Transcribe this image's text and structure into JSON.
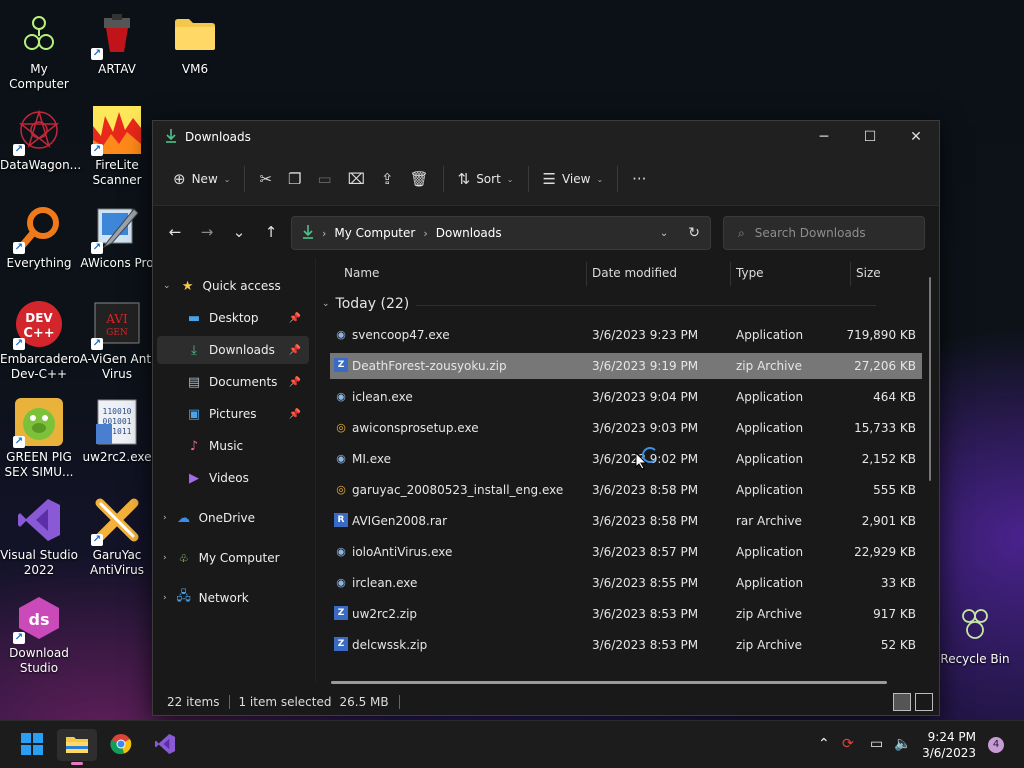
{
  "desktop": {
    "icons": [
      {
        "label": "My Computer"
      },
      {
        "label": "ARTAV"
      },
      {
        "label": "VM6"
      },
      {
        "label": "DataWagon..."
      },
      {
        "label": "FireLite Scanner"
      },
      {
        "label": "Everything"
      },
      {
        "label": "AWicons Pro"
      },
      {
        "label": "Embarcadero Dev-C++"
      },
      {
        "label": "A-ViGen Anti Virus"
      },
      {
        "label": "GREEN PIG SEX SIMU..."
      },
      {
        "label": "uw2rc2.exe"
      },
      {
        "label": "Visual Studio 2022"
      },
      {
        "label": "GaruYac AntiVirus"
      },
      {
        "label": "Download Studio"
      },
      {
        "label": "Recycle Bin"
      }
    ]
  },
  "window": {
    "title": "Downloads",
    "controls": {
      "minimize": "─",
      "maximize": "☐",
      "close": "✕"
    }
  },
  "toolbar": {
    "new_label": "New",
    "sort_label": "Sort",
    "view_label": "View",
    "more_label": "···"
  },
  "address": {
    "segments": [
      "My Computer",
      "Downloads"
    ],
    "search_placeholder": "Search Downloads"
  },
  "nav": {
    "quick_access": "Quick access",
    "items": [
      {
        "label": "Desktop"
      },
      {
        "label": "Downloads"
      },
      {
        "label": "Documents"
      },
      {
        "label": "Pictures"
      },
      {
        "label": "Music"
      },
      {
        "label": "Videos"
      }
    ],
    "onedrive": "OneDrive",
    "my_computer": "My Computer",
    "network": "Network"
  },
  "columns": {
    "name": "Name",
    "date": "Date modified",
    "type": "Type",
    "size": "Size"
  },
  "group": {
    "label": "Today (22)"
  },
  "files": [
    {
      "name": "svencoop47.exe",
      "date": "3/6/2023 9:23 PM",
      "type": "Application",
      "size": "719,890 KB",
      "icon": "app-icon"
    },
    {
      "name": "DeathForest-zousyoku.zip",
      "date": "3/6/2023 9:19 PM",
      "type": "zip Archive",
      "size": "27,206 KB",
      "icon": "zip-icon"
    },
    {
      "name": "iclean.exe",
      "date": "3/6/2023 9:04 PM",
      "type": "Application",
      "size": "464 KB",
      "icon": "app-icon"
    },
    {
      "name": "awiconsprosetup.exe",
      "date": "3/6/2023 9:03 PM",
      "type": "Application",
      "size": "15,733 KB",
      "icon": "setup-icon"
    },
    {
      "name": "MI.exe",
      "date": "3/6/2023 9:02 PM",
      "type": "Application",
      "size": "2,152 KB",
      "icon": "app-icon"
    },
    {
      "name": "garuyac_20080523_install_eng.exe",
      "date": "3/6/2023 8:58 PM",
      "type": "Application",
      "size": "555 KB",
      "icon": "setup-icon"
    },
    {
      "name": "AVIGen2008.rar",
      "date": "3/6/2023 8:58 PM",
      "type": "rar Archive",
      "size": "2,901 KB",
      "icon": "rar-icon"
    },
    {
      "name": "ioloAntiVirus.exe",
      "date": "3/6/2023 8:57 PM",
      "type": "Application",
      "size": "22,929 KB",
      "icon": "app-icon"
    },
    {
      "name": "irclean.exe",
      "date": "3/6/2023 8:55 PM",
      "type": "Application",
      "size": "33 KB",
      "icon": "app-icon"
    },
    {
      "name": "uw2rc2.zip",
      "date": "3/6/2023 8:53 PM",
      "type": "zip Archive",
      "size": "917 KB",
      "icon": "zip-icon"
    },
    {
      "name": "delcwssk.zip",
      "date": "3/6/2023 8:53 PM",
      "type": "zip Archive",
      "size": "52 KB",
      "icon": "zip-icon"
    }
  ],
  "status": {
    "count": "22 items",
    "selected": "1 item selected",
    "size": "26.5 MB"
  },
  "taskbar": {
    "time": "9:24 PM",
    "date": "3/6/2023",
    "notifications": "4"
  }
}
